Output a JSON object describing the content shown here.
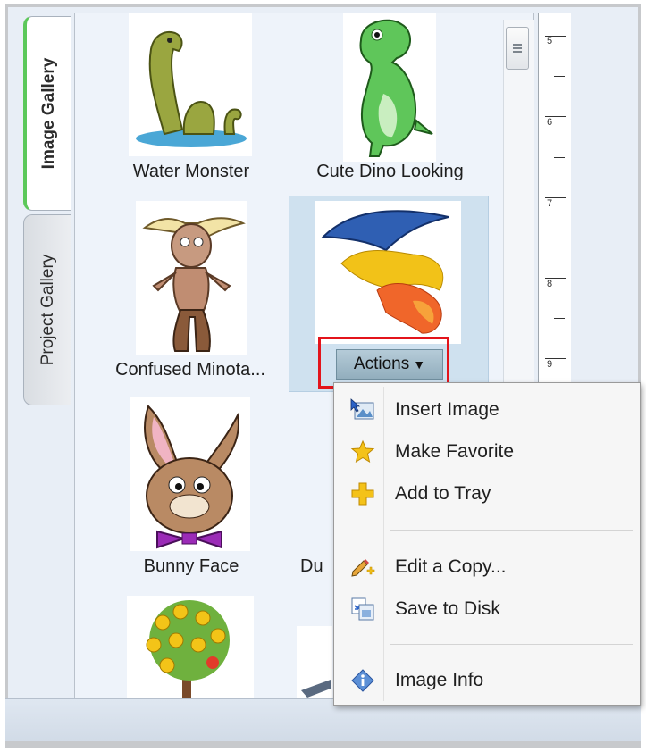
{
  "tabs": {
    "image_gallery": "Image Gallery",
    "project_gallery": "Project Gallery"
  },
  "gallery": {
    "items": [
      {
        "caption": "Water Monster",
        "art": "sea-monster"
      },
      {
        "caption": "Cute Dino Looking",
        "art": "green-dinosaur"
      },
      {
        "caption": "Confused Minota...",
        "art": "minotaur"
      },
      {
        "caption": "",
        "art": "dragon-fire"
      },
      {
        "caption": "Bunny Face",
        "art": "bunny"
      },
      {
        "caption": "Du",
        "art": "partial-hidden"
      },
      {
        "caption": "",
        "art": "flower-tree"
      },
      {
        "caption": "",
        "art": "partial-hidden-2"
      }
    ]
  },
  "actions": {
    "label": "Actions",
    "caret": "▼"
  },
  "menu": {
    "items": [
      {
        "label": "Insert Image",
        "icon": "insert-image-icon"
      },
      {
        "label": "Make Favorite",
        "icon": "star-icon"
      },
      {
        "label": "Add to Tray",
        "icon": "plus-icon"
      },
      {
        "label": "Edit a Copy...",
        "icon": "pencil-plus-icon"
      },
      {
        "label": "Save to Disk",
        "icon": "save-copy-icon"
      },
      {
        "label": "Image Info",
        "icon": "info-icon"
      }
    ]
  },
  "ruler": {
    "marks": [
      "5",
      "6",
      "7",
      "8",
      "9"
    ]
  },
  "colors": {
    "accent_tab": "#5cc85a",
    "highlight": "#e3141b",
    "selected": "#cfe1ef"
  }
}
